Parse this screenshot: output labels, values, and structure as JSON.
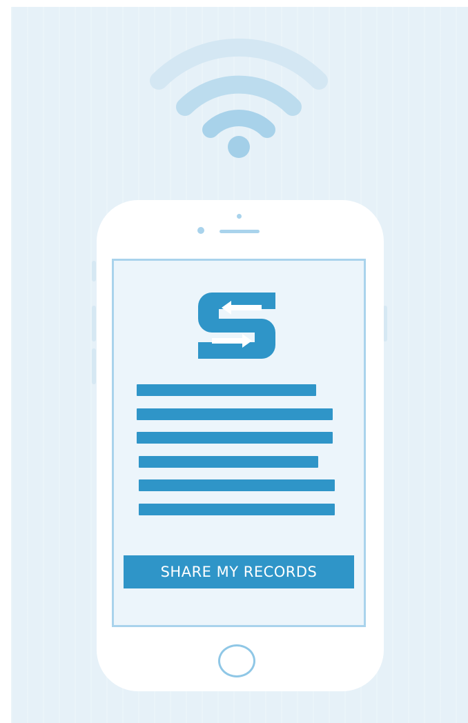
{
  "share_button": {
    "label": "SHARE MY RECORDS"
  },
  "icons": {
    "wifi": "wifi-icon",
    "logo": "s-arrows-logo",
    "home": "home-button"
  },
  "colors": {
    "background": "#e6f1f8",
    "accent": "#2f95c8",
    "outline": "#a9d3ec",
    "wifi_light": "#d4e7f3",
    "wifi_mid": "#bcdcee",
    "wifi_dark": "#a8d2ea"
  }
}
